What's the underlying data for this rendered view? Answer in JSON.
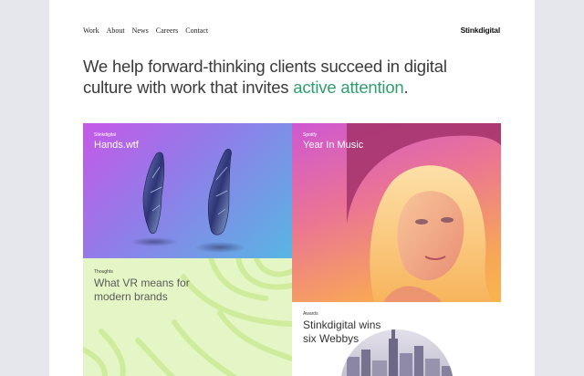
{
  "nav": {
    "items": [
      "Work",
      "About",
      "News",
      "Careers",
      "Contact"
    ],
    "logo": "Stinkdigital"
  },
  "hero": {
    "text": "We help forward-thinking clients succeed in digital culture with work that invites ",
    "accent": "active attention",
    "end": "."
  },
  "tiles": {
    "hands": {
      "client": "Stinkdigital",
      "title": "Hands.wtf"
    },
    "spotify": {
      "client": "Spotify",
      "title": "Year In Music"
    },
    "vr": {
      "client": "Thoughts",
      "title_line1": "What VR means for",
      "title_line2": "modern brands"
    },
    "awards": {
      "client": "Awards",
      "title_line1": "Stinkdigital wins",
      "title_line2": "six Webbys"
    }
  },
  "colors": {
    "accent": "#2f9e6e",
    "vr_tile": "#e4f6c5"
  }
}
